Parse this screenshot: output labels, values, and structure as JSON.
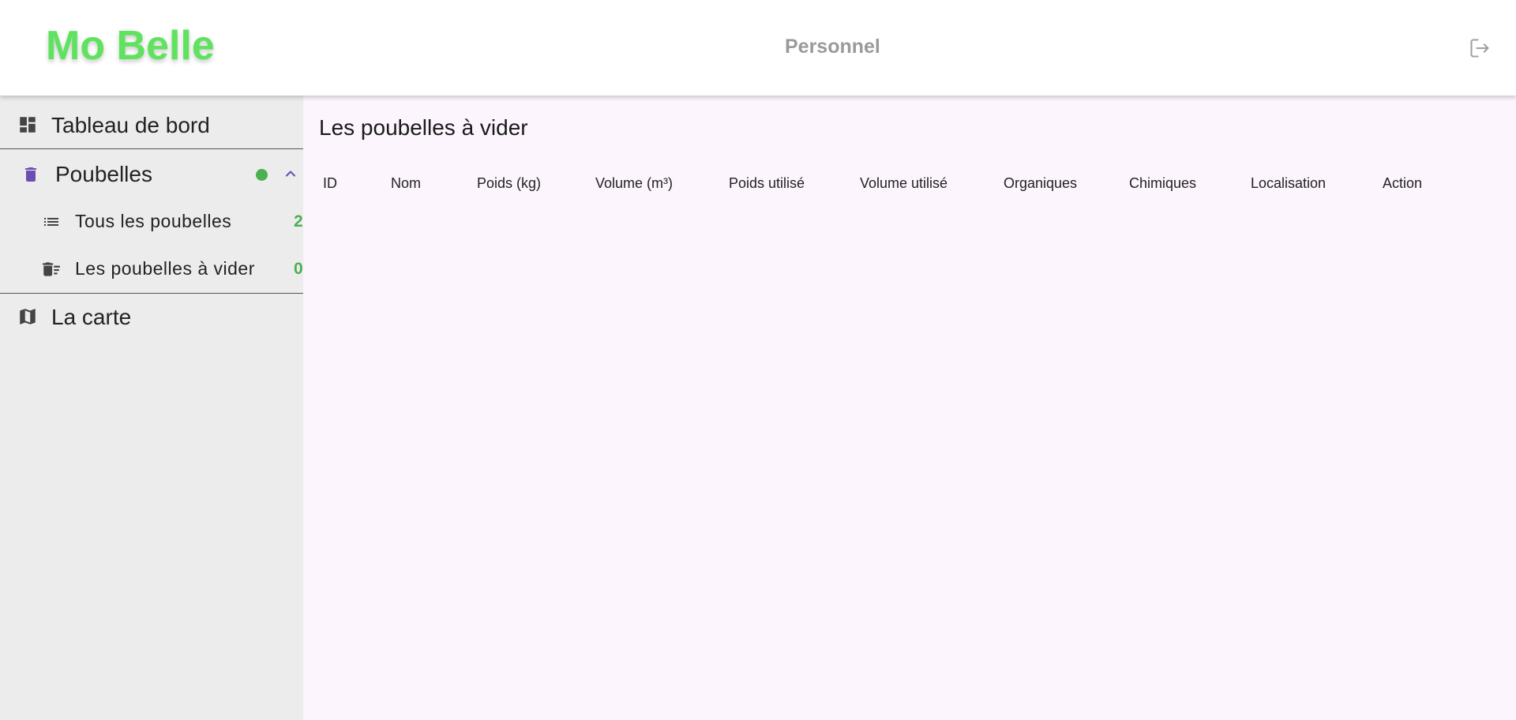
{
  "header": {
    "logo": "Mo Belle",
    "section": "Personnel",
    "logout_icon": "logout-icon"
  },
  "sidebar": {
    "items": [
      {
        "label": "Tableau de bord",
        "icon": "dashboard-icon"
      },
      {
        "label": "Poubelles",
        "icon": "trash-icon",
        "expanded": true,
        "status_color": "#4caf50",
        "children": [
          {
            "label": "Tous les poubelles",
            "icon": "list-icon",
            "count": "2"
          },
          {
            "label": "Les poubelles à vider",
            "icon": "trash-sweep-icon",
            "count": "0"
          }
        ]
      },
      {
        "label": "La carte",
        "icon": "map-icon"
      }
    ]
  },
  "main": {
    "title": "Les poubelles à vider",
    "columns": [
      "ID",
      "Nom",
      "Poids (kg)",
      "Volume (m³)",
      "Poids utilisé",
      "Volume utilisé",
      "Organiques",
      "Chimiques",
      "Localisation",
      "Action"
    ]
  },
  "colors": {
    "brand": "#5fe35f",
    "accent": "#6a4fb0",
    "count": "#4caf50"
  }
}
